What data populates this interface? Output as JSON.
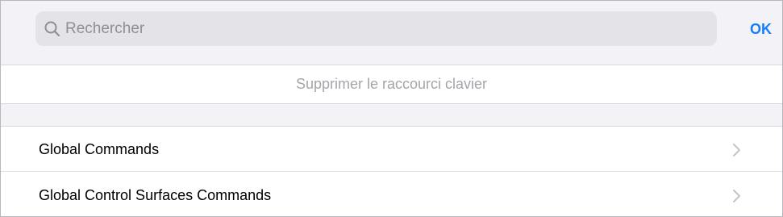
{
  "search": {
    "placeholder": "Rechercher",
    "value": "",
    "icon": "search-icon"
  },
  "header": {
    "ok_label": "OK",
    "accent_color": "#157efb"
  },
  "delete_shortcut_label": "Supprimer le raccourci clavier",
  "commands": {
    "items": [
      {
        "label": "Global Commands",
        "icon": "chevron-right-icon"
      },
      {
        "label": "Global Control Surfaces Commands",
        "icon": "chevron-right-icon"
      }
    ]
  }
}
